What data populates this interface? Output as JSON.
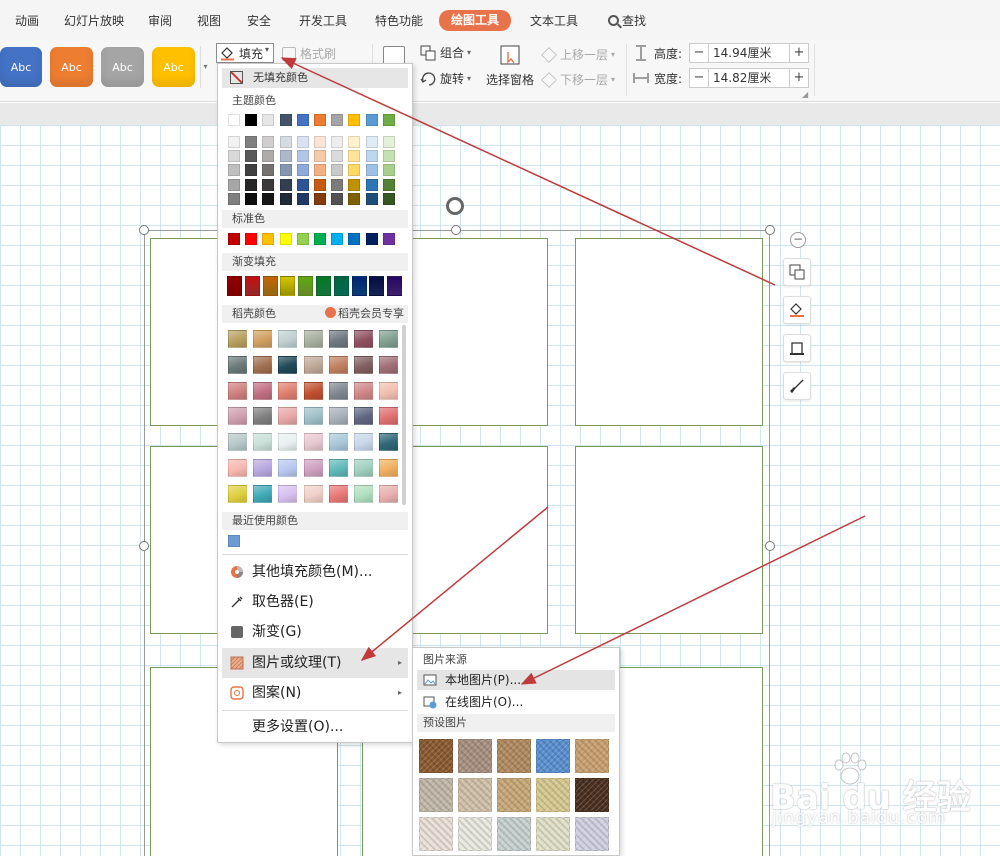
{
  "tabs": [
    {
      "label": "动画"
    },
    {
      "label": "幻灯片放映"
    },
    {
      "label": "审阅"
    },
    {
      "label": "视图"
    },
    {
      "label": "安全"
    },
    {
      "label": "开发工具"
    },
    {
      "label": "特色功能"
    },
    {
      "label": "绘图工具",
      "active": true
    },
    {
      "label": "文本工具"
    },
    {
      "label": "查找",
      "icon": "search-icon"
    }
  ],
  "ribbon": {
    "shape_styles": [
      {
        "label": "Abc",
        "color": "#4472c4"
      },
      {
        "label": "Abc",
        "color": "#ed7d31"
      },
      {
        "label": "Abc",
        "color": "#a5a5a5"
      },
      {
        "label": "Abc",
        "color": "#ffc000"
      }
    ],
    "fill_label": "填充",
    "format_painter_label": "格式刷",
    "group_label": "组合",
    "rotate_label": "旋转",
    "selection_pane_label": "选择窗格",
    "bring_forward_label": "上移一层",
    "send_backward_label": "下移一层",
    "height_label": "高度:",
    "height_value": "14.94厘米",
    "width_label": "宽度:",
    "width_value": "14.82厘米",
    "minus": "−",
    "plus": "+"
  },
  "fill_menu": {
    "no_fill": "无填充颜色",
    "theme_colors_title": "主题颜色",
    "theme_colors": [
      "#ffffff",
      "#000000",
      "#e7e6e6",
      "#44546a",
      "#4472c4",
      "#ed7d31",
      "#a5a5a5",
      "#ffc000",
      "#5b9bd5",
      "#70ad47"
    ],
    "theme_shades": [
      [
        "#f2f2f2",
        "#808080",
        "#d0cece",
        "#d6dce4",
        "#d9e2f3",
        "#fbe4d5",
        "#ededed",
        "#fff2cc",
        "#deeaf6",
        "#e2efd9"
      ],
      [
        "#d9d9d9",
        "#595959",
        "#aeabab",
        "#adb9ca",
        "#b4c6e7",
        "#f7caac",
        "#dbdbdb",
        "#ffe599",
        "#bdd7ee",
        "#c5e0b3"
      ],
      [
        "#bfbfbf",
        "#404040",
        "#757171",
        "#8497b0",
        "#8eaadb",
        "#f4b083",
        "#c9c9c9",
        "#ffd966",
        "#9cc3e5",
        "#a8d08d"
      ],
      [
        "#a6a6a6",
        "#262626",
        "#3a3838",
        "#323f4f",
        "#2f5496",
        "#c55a11",
        "#7b7b7b",
        "#bf9000",
        "#2e75b5",
        "#538135"
      ],
      [
        "#7f7f7f",
        "#0d0d0d",
        "#171616",
        "#222a35",
        "#1f3864",
        "#833c0b",
        "#525252",
        "#7f6000",
        "#1e4e79",
        "#375623"
      ]
    ],
    "standard_colors_title": "标准色",
    "standard_colors": [
      "#c00000",
      "#ff0000",
      "#ffc000",
      "#ffff00",
      "#92d050",
      "#00b050",
      "#00b0f0",
      "#0070c0",
      "#002060",
      "#7030a0"
    ],
    "gradient_title": "渐变填充",
    "gradient_colors": [
      "#c00000",
      "#e04040",
      "#e0a020",
      "#e8e000",
      "#9ad040",
      "#20b060",
      "#10a080",
      "#1060b0",
      "#203880",
      "#6030a0"
    ],
    "docer_title": "稻壳颜色",
    "vip_label": "稻壳会员专享",
    "docer_colors": [
      [
        "#b8a060",
        "#d0a060",
        "#c0d0d0",
        "#a8b0a0",
        "#707880",
        "#905060",
        "#80a090"
      ],
      [
        "#6a7a78",
        "#a07050",
        "#204858",
        "#c0a898",
        "#c08060",
        "#806060",
        "#a07078"
      ],
      [
        "#d08080",
        "#c07080",
        "#e08070",
        "#c05030",
        "#808890",
        "#d08888",
        "#f0c0b0"
      ],
      [
        "#d0a0b0",
        "#808080",
        "#e8a8a8",
        "#a0c0c8",
        "#a8b0b8",
        "#606880",
        "#e07070"
      ],
      [
        "#b8c8c8",
        "#c8e0d8",
        "#e8f0f0",
        "#e8c8d0",
        "#a8c8d8",
        "#c8d8e8",
        "#306878"
      ],
      [
        "#f8b8b0",
        "#b8a8e0",
        "#b8c8f0",
        "#d0a0c0",
        "#60b8b8",
        "#a0d0c0",
        "#f0b060"
      ],
      [
        "#e0d040",
        "#40a8b8",
        "#d8c0f0",
        "#f0d0c8",
        "#e87878",
        "#b0e0c0",
        "#e8b0b0"
      ]
    ],
    "recent_title": "最近使用颜色",
    "recent_colors": [
      "#6b9bd2"
    ],
    "more_colors": "其他填充颜色(M)...",
    "eyedropper": "取色器(E)",
    "gradient": "渐变(G)",
    "picture_texture": "图片或纹理(T)",
    "pattern": "图案(N)",
    "more_settings": "更多设置(O)..."
  },
  "picture_submenu": {
    "source_title": "图片来源",
    "local_picture": "本地图片(P)...",
    "online_picture": "在线图片(O)...",
    "preset_title": "预设图片",
    "textures": [
      [
        "#8a5a30",
        "#a89080",
        "#b08a60",
        "#5a90d0",
        "#c8a070"
      ],
      [
        "#c0b8a8",
        "#d0c0a8",
        "#c8a878",
        "#d8c890",
        "#4a3020"
      ],
      [
        "#e8e0d8",
        "#e8e8e0",
        "#c8d0d0",
        "#e0e0c8",
        "#d0d0e0"
      ]
    ]
  },
  "watermark": {
    "brand": "Bai du 经验",
    "url": "jingyan.baidu.com"
  },
  "colors": {
    "active_tab": "#e8734a",
    "arrow": "#c0393b",
    "grid_line": "#cfe6ee",
    "cell_border": "#7a9a5c"
  }
}
